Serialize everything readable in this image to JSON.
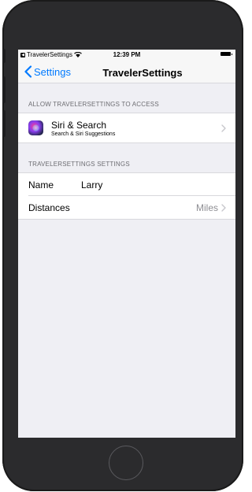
{
  "status_bar": {
    "app_name": "TravelerSettings",
    "time": "12:39 PM"
  },
  "nav": {
    "back_label": "Settings",
    "title": "TravelerSettings"
  },
  "access_section": {
    "header": "ALLOW TRAVELERSETTINGS TO ACCESS",
    "siri": {
      "title": "Siri & Search",
      "subtitle": "Search & Siri Suggestions",
      "icon": "siri-icon"
    }
  },
  "settings_section": {
    "header": "TRAVELERSETTINGS SETTINGS",
    "name": {
      "label": "Name",
      "value": "Larry"
    },
    "distances": {
      "label": "Distances",
      "value": "Miles"
    }
  },
  "colors": {
    "accent": "#007aff",
    "background": "#efeff4",
    "secondary_text": "#8e8e93"
  }
}
